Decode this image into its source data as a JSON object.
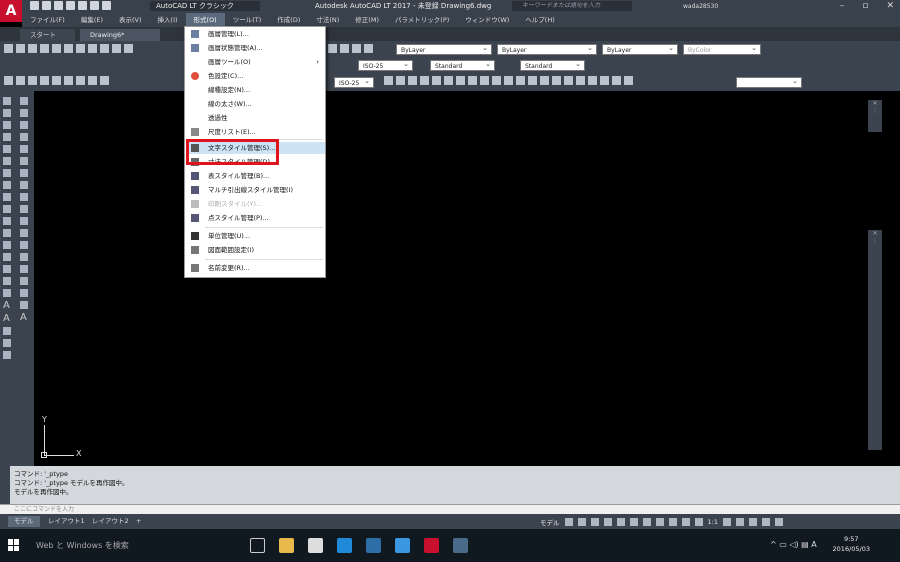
{
  "titlebar": {
    "logo": "A",
    "workspace": "AutoCAD LT クラシック",
    "title": "Autodesk AutoCAD LT 2017 - 未登録    Drawing6.dwg",
    "search_placeholder": "キーワードまたは語句を入力",
    "user": "wada28530"
  },
  "menubar": {
    "items": [
      "ファイル(F)",
      "編集(E)",
      "表示(V)",
      "挿入(I)",
      "形式(O)",
      "ツール(T)",
      "作成(D)",
      "寸法(N)",
      "修正(M)",
      "パラメトリック(P)",
      "ウィンドウ(W)",
      "ヘルプ(H)"
    ],
    "active_index": 4
  },
  "tabs": {
    "start": "スタート",
    "doc": "Drawing6*"
  },
  "toolbar": {
    "layer_current": "0",
    "color_combo": "ByLayer",
    "linetype_combo": "ByLayer",
    "lineweight_combo": "ByLayer",
    "plotstyle_combo": "ByColor",
    "dim_style_1": "ISO-25",
    "text_style": "Standard",
    "table_style": "Standard",
    "dim_style_2": "ISO-25"
  },
  "format_menu": {
    "items": [
      {
        "label": "画層管理(L)...",
        "icon": "layers-icon"
      },
      {
        "label": "画層状態管理(A)...",
        "icon": "layer-state-icon"
      },
      {
        "label": "画層ツール(O)",
        "icon": "",
        "submenu": true
      },
      {
        "label": "色設定(C)...",
        "icon": "color-wheel-icon"
      },
      {
        "label": "線種設定(N)...",
        "icon": ""
      },
      {
        "label": "線の太さ(W)...",
        "icon": ""
      },
      {
        "label": "透過性",
        "icon": ""
      },
      {
        "label": "尺度リスト(E)...",
        "icon": "scale-list-icon"
      },
      {
        "label": "文字スタイル管理(S)...",
        "icon": "text-style-icon",
        "highlighted": true
      },
      {
        "label": "寸法スタイル管理(D)...",
        "icon": "dim-style-icon"
      },
      {
        "label": "表スタイル管理(B)...",
        "icon": "table-style-icon"
      },
      {
        "label": "マルチ引出線スタイル管理(I)",
        "icon": "mleader-style-icon"
      },
      {
        "label": "印刷スタイル(Y)...",
        "icon": "plot-style-icon",
        "disabled": true
      },
      {
        "label": "点スタイル管理(P)...",
        "icon": "point-style-icon"
      },
      {
        "label": "単位管理(U)...",
        "icon": "units-icon"
      },
      {
        "label": "図面範囲設定(I)",
        "icon": "limits-icon"
      },
      {
        "label": "名前変更(R)...",
        "icon": "rename-icon"
      }
    ]
  },
  "ucs": {
    "y_label": "Y",
    "x_label": "X"
  },
  "command": {
    "history": [
      "コマンド: '_ptype",
      "コマンド: '_ptype モデルを再作図中。",
      "モデルを再作図中。"
    ],
    "input_placeholder": "ここにコマンドを入力"
  },
  "layouts": {
    "model": "モデル",
    "layout1": "レイアウト1",
    "layout2": "レイアウト2",
    "add": "+"
  },
  "statusbar": {
    "model_label": "モデル",
    "scale": "1:1"
  },
  "taskbar": {
    "search": "Web と Windows を検索",
    "time": "9:57",
    "date": "2016/05/03",
    "ime": "A"
  },
  "colors": {
    "accent_red": "#e0141e",
    "menu_highlight": "#cde4f7",
    "autocad_red": "#c8102e"
  }
}
